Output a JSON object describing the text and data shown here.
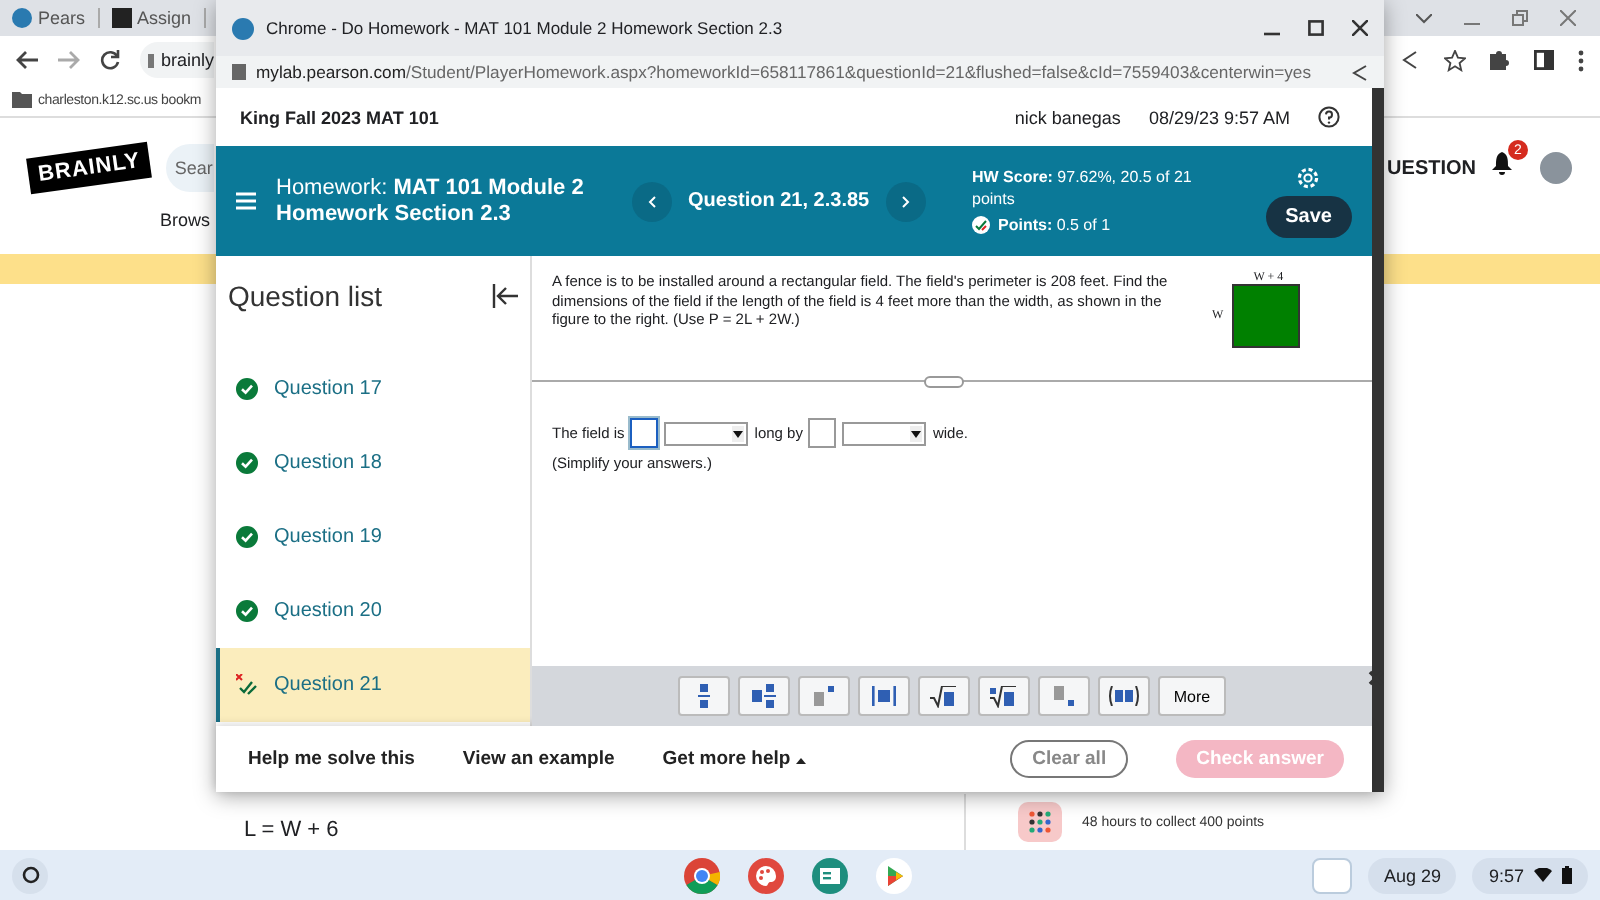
{
  "background_browser": {
    "tabs": [
      {
        "label": "Pears"
      },
      {
        "label": "Assign"
      }
    ],
    "address": "brainly",
    "bookmark": "charleston.k12.sc.us bookm",
    "page": {
      "logo": "BRAINLY",
      "search_placeholder": "Sear",
      "browse": "Brows",
      "ask_button": "UESTION",
      "notification_count": "2",
      "answer_line": "L = W + 6",
      "reward_text": "48 hours to collect 400 points"
    }
  },
  "popup": {
    "title": "Chrome - Do Homework - MAT 101 Module 2 Homework Section 2.3",
    "url_host": "mylab.pearson.com",
    "url_path": "/Student/PlayerHomework.aspx?homeworkId=658117861&questionId=21&flushed=false&cId=7559403&centerwin=yes",
    "course": "King Fall 2023 MAT 101",
    "user": "nick banegas",
    "datetime": "08/29/23 9:57 AM",
    "homework_title": "Homework:  **MAT 101 Module 2 Homework Section 2.3**",
    "question_label": "Question 21, 2.3.85",
    "hw_score": "**HW Score:** 97.62%, 20.5 of 21 points",
    "points": "**Points:** 0.5 of 1",
    "save": "Save",
    "question_list_title": "Question list",
    "questions": [
      {
        "label": "Question 17",
        "kind": "correct",
        "selected": false
      },
      {
        "label": "Question 18",
        "kind": "correct",
        "selected": false
      },
      {
        "label": "Question 19",
        "kind": "correct",
        "selected": false
      },
      {
        "label": "Question 20",
        "kind": "correct",
        "selected": false
      },
      {
        "label": "Question 21",
        "kind": "partial",
        "selected": true
      }
    ],
    "question_text": "A fence is to be installed around a rectangular field. The field's perimeter is 208 feet. Find the dimensions of the field if the length of the field is 4 feet more than the width, as shown in the figure to the right. (Use P = 2L + 2W.)",
    "figure": {
      "top_label": "W + 4",
      "side_label": "W"
    },
    "answer_parts": [
      {
        "kind": "text",
        "text": "The field is"
      },
      {
        "kind": "input",
        "focused": true
      },
      {
        "kind": "select"
      },
      {
        "kind": "text",
        "text": "long by"
      },
      {
        "kind": "input",
        "focused": false
      },
      {
        "kind": "select"
      },
      {
        "kind": "text",
        "text": "wide."
      }
    ],
    "hint": "(Simplify your answers.)",
    "math_tools": [
      {
        "kind": "fraction"
      },
      {
        "kind": "mixed"
      },
      {
        "kind": "exponent"
      },
      {
        "kind": "abs"
      },
      {
        "kind": "sqrt"
      },
      {
        "kind": "nthroot"
      },
      {
        "kind": "subscript"
      },
      {
        "kind": "pair"
      }
    ],
    "more": "More",
    "help_links": [
      "Help me solve this",
      "View an example"
    ],
    "more_help": "Get more help",
    "clear": "Clear all",
    "check": {
      "label": "Check answer",
      "disabled": true
    }
  },
  "taskbar": {
    "apps": [
      {
        "kind": "chrome"
      },
      {
        "kind": "paint"
      },
      {
        "kind": "classroom"
      },
      {
        "kind": "play"
      }
    ],
    "date": "Aug 29",
    "time": "9:57"
  }
}
